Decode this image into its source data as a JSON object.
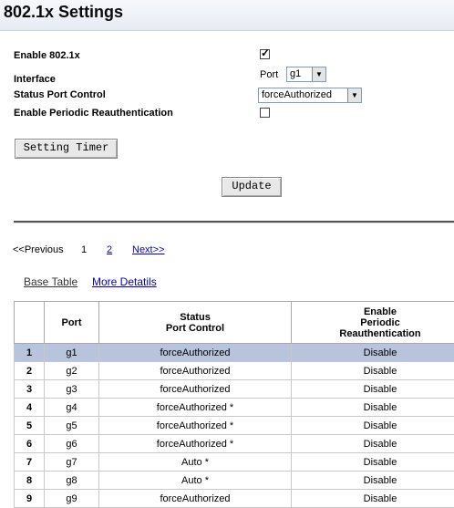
{
  "title": "802.1x Settings",
  "form": {
    "enable_label": "Enable 802.1x",
    "interface_label": "Interface",
    "port_label": "Port",
    "port_value": "g1",
    "status_label": "Status Port Control",
    "status_value": "forceAuthorized",
    "reauth_label": "Enable Periodic Reauthentication",
    "enable_checked": true,
    "reauth_checked": false
  },
  "buttons": {
    "setting_timer": "Setting Timer",
    "update": "Update"
  },
  "pager": {
    "prev": "<<Previous",
    "page1": "1",
    "page2": "2",
    "next": "Next>>"
  },
  "tabs": {
    "base": "Base Table",
    "more": "More Detatils"
  },
  "table": {
    "headers": [
      "",
      "Port",
      "Status\nPort Control",
      "Enable\nPeriodic\nReauthentication"
    ],
    "rows": [
      [
        "1",
        "g1",
        "forceAuthorized",
        "Disable"
      ],
      [
        "2",
        "g2",
        "forceAuthorized",
        "Disable"
      ],
      [
        "3",
        "g3",
        "forceAuthorized",
        "Disable"
      ],
      [
        "4",
        "g4",
        "forceAuthorized *",
        "Disable"
      ],
      [
        "5",
        "g5",
        "forceAuthorized *",
        "Disable"
      ],
      [
        "6",
        "g6",
        "forceAuthorized *",
        "Disable"
      ],
      [
        "7",
        "g7",
        "Auto *",
        "Disable"
      ],
      [
        "8",
        "g8",
        "Auto *",
        "Disable"
      ],
      [
        "9",
        "g9",
        "forceAuthorized",
        "Disable"
      ]
    ],
    "selected_row": 0
  }
}
